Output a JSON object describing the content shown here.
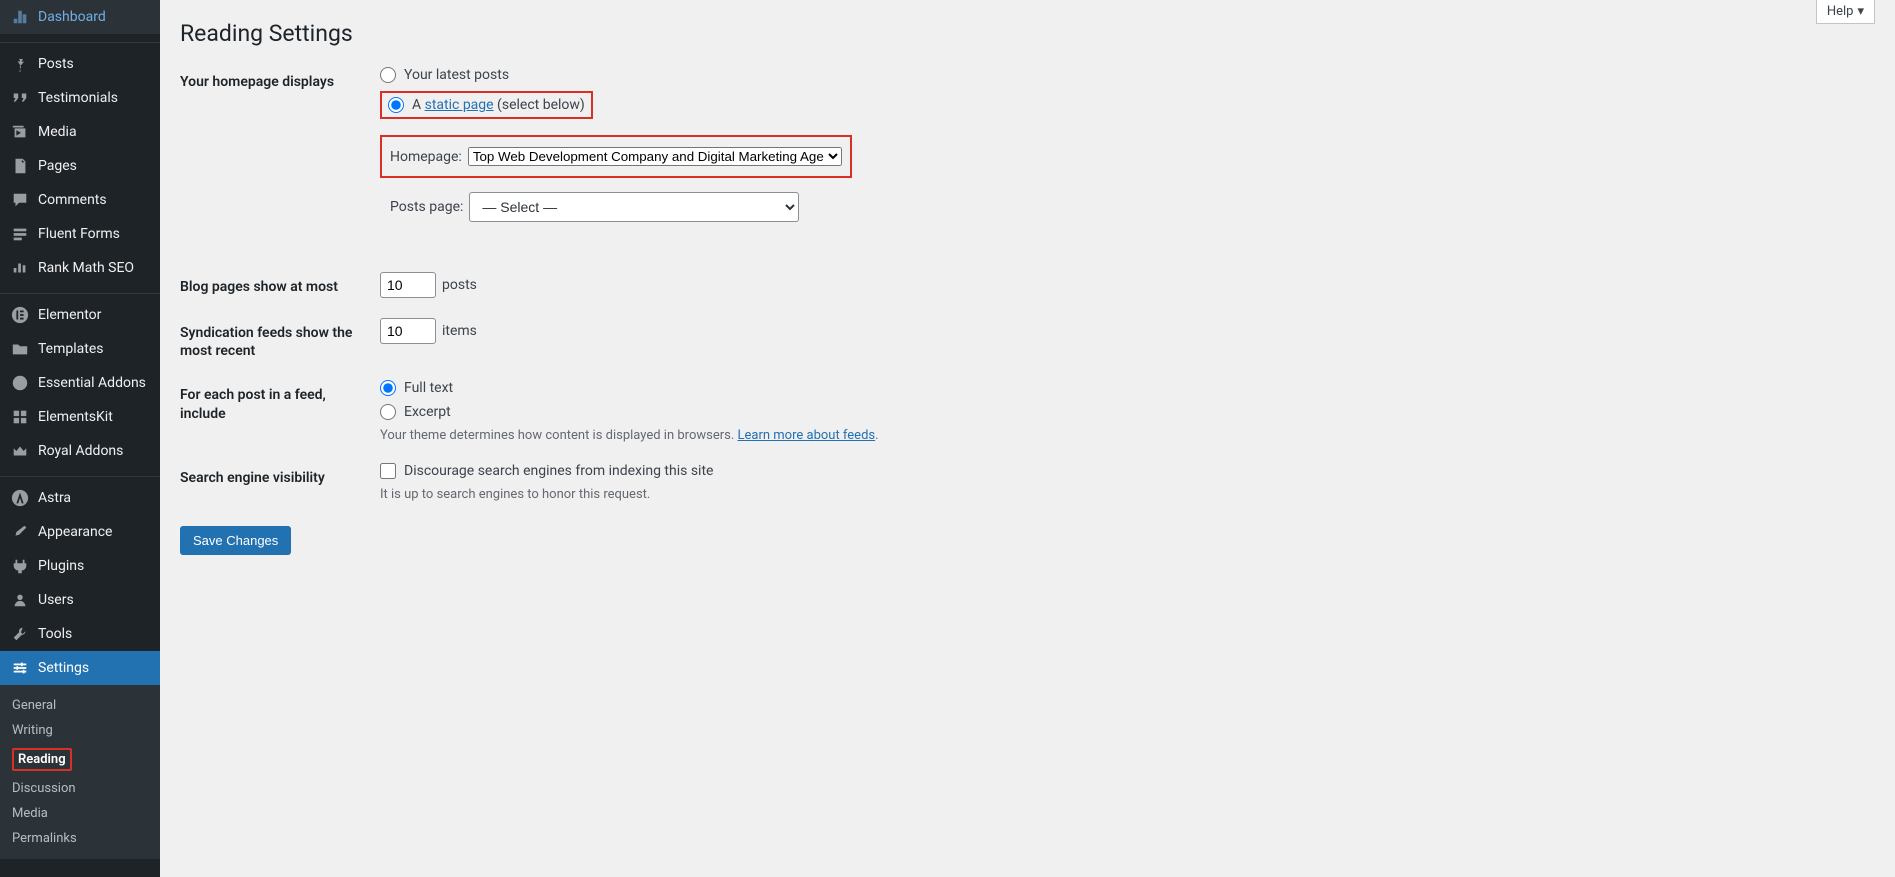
{
  "sidebar": {
    "items": [
      {
        "label": "Dashboard",
        "icon": "dashboard"
      },
      {
        "label": "Posts",
        "icon": "pin"
      },
      {
        "label": "Testimonials",
        "icon": "quotes"
      },
      {
        "label": "Media",
        "icon": "media"
      },
      {
        "label": "Pages",
        "icon": "pages"
      },
      {
        "label": "Comments",
        "icon": "comments"
      },
      {
        "label": "Fluent Forms",
        "icon": "forms"
      },
      {
        "label": "Rank Math SEO",
        "icon": "chart"
      },
      {
        "label": "Elementor",
        "icon": "elementor"
      },
      {
        "label": "Templates",
        "icon": "folder"
      },
      {
        "label": "Essential Addons",
        "icon": "ea"
      },
      {
        "label": "ElementsKit",
        "icon": "ek"
      },
      {
        "label": "Royal Addons",
        "icon": "crown"
      },
      {
        "label": "Astra",
        "icon": "astra"
      },
      {
        "label": "Appearance",
        "icon": "brush"
      },
      {
        "label": "Plugins",
        "icon": "plugin"
      },
      {
        "label": "Users",
        "icon": "users"
      },
      {
        "label": "Tools",
        "icon": "tools"
      },
      {
        "label": "Settings",
        "icon": "settings"
      }
    ],
    "submenu": [
      {
        "label": "General"
      },
      {
        "label": "Writing"
      },
      {
        "label": "Reading"
      },
      {
        "label": "Discussion"
      },
      {
        "label": "Media"
      },
      {
        "label": "Permalinks"
      }
    ]
  },
  "help_label": "Help",
  "page_title": "Reading Settings",
  "form": {
    "homepage_displays": {
      "label": "Your homepage displays",
      "opt_latest": "Your latest posts",
      "opt_static_prefix": "A ",
      "opt_static_link": "static page",
      "opt_static_suffix": " (select below)",
      "homepage_label": "Homepage:",
      "homepage_selected": "Top Web Development Company and Digital Marketing Age",
      "posts_page_label": "Posts page:",
      "posts_page_selected": "— Select —"
    },
    "blog_pages": {
      "label": "Blog pages show at most",
      "value": "10",
      "suffix": "posts"
    },
    "syndication": {
      "label": "Syndication feeds show the most recent",
      "value": "10",
      "suffix": "items"
    },
    "feed_include": {
      "label": "For each post in a feed, include",
      "opt_full": "Full text",
      "opt_excerpt": "Excerpt",
      "desc_prefix": "Your theme determines how content is displayed in browsers. ",
      "desc_link": "Learn more about feeds",
      "desc_suffix": "."
    },
    "search_visibility": {
      "label": "Search engine visibility",
      "checkbox_label": "Discourage search engines from indexing this site",
      "desc": "It is up to search engines to honor this request."
    },
    "save_button": "Save Changes"
  }
}
